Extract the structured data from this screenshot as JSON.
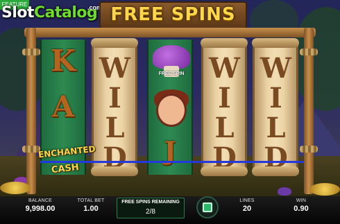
{
  "header": {
    "title": "FREE SPINS",
    "logo_left": "Slot",
    "logo_right": "Catalog",
    "logo_suffix": ".com",
    "corner_tag": "FEATURE"
  },
  "reels": {
    "reel1": {
      "top": "K",
      "middle": "A"
    },
    "reel3": {
      "mushroom_label": "FREE SPIN",
      "bottom": "J"
    },
    "wild_text": "WILD"
  },
  "feature": {
    "line1": "ENCHANTED",
    "line2": "CASH"
  },
  "status_bar": {
    "balance_label": "BALANCE",
    "balance_value": "9,998.00",
    "total_bet_label": "TOTAL BET",
    "total_bet_value": "1.00",
    "free_spins_label": "FREE SPINS REMAINING",
    "free_spins_value": "2/8",
    "lines_label": "LINES",
    "lines_value": "20",
    "win_label": "WIN",
    "win_value": "0.90"
  },
  "colors": {
    "title": "#ffd54a",
    "payline": "#2438e0",
    "spin_button": "#2bb86a",
    "logo_accent": "#6ddc2e"
  },
  "icons": [
    "spin-icon",
    "mushroom-icon",
    "fairy-icon",
    "coins-icon"
  ]
}
